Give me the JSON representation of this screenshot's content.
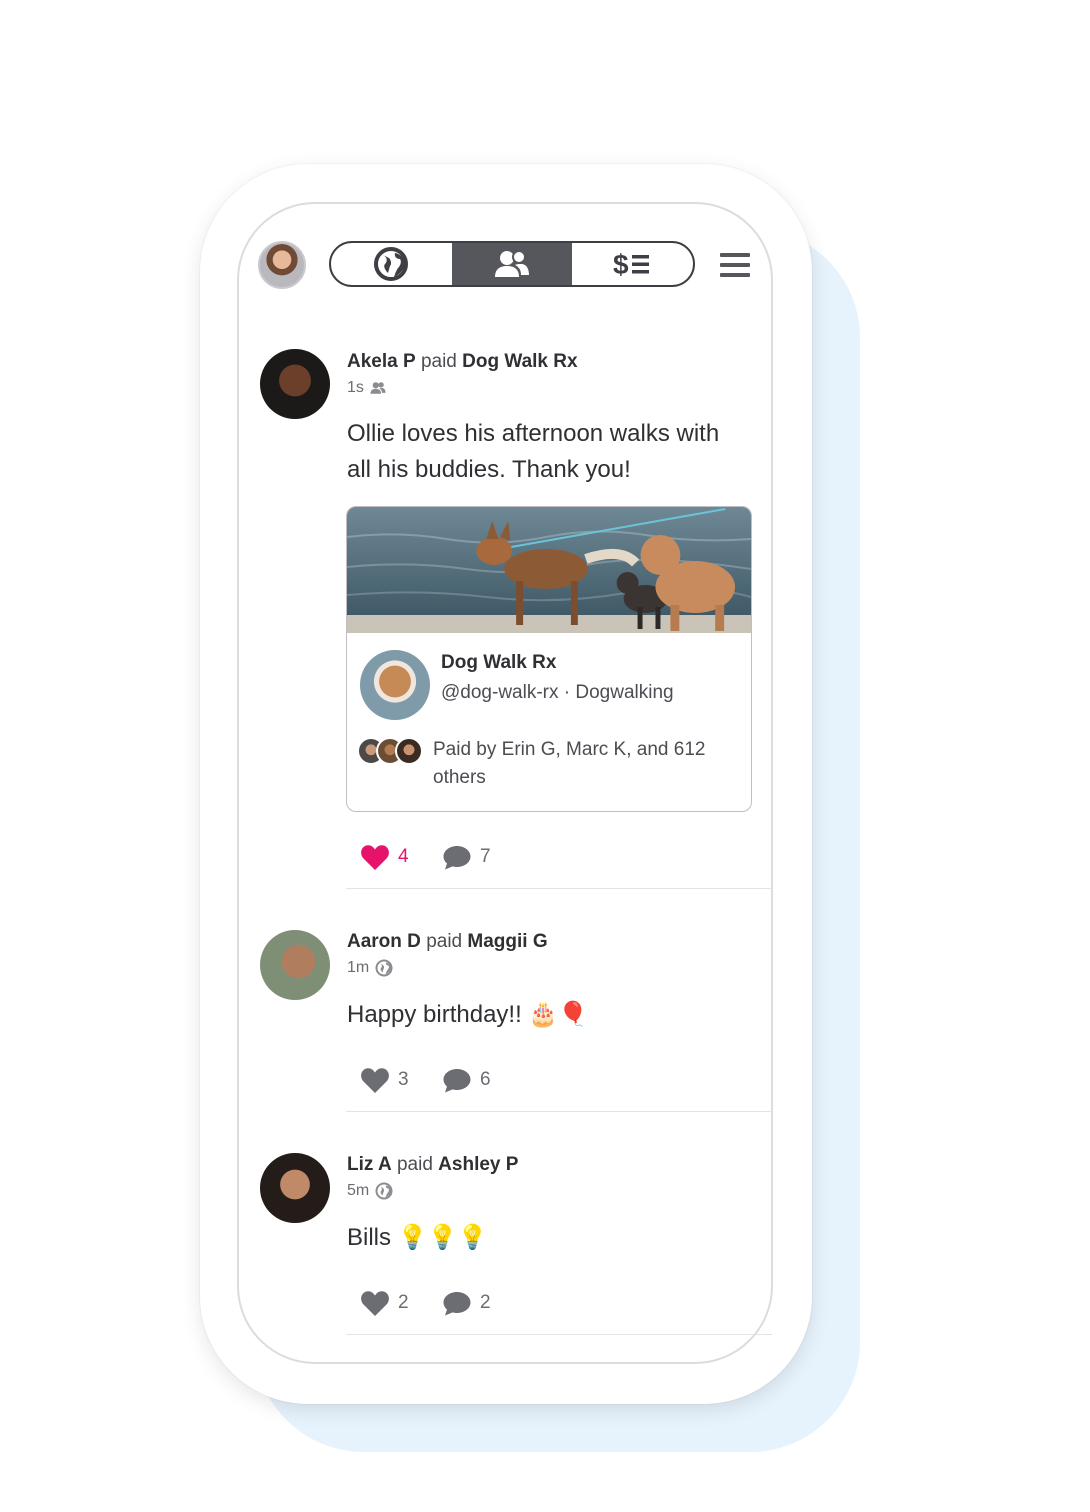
{
  "colors": {
    "accent_heart": "#e7136b",
    "icon_gray": "#6b6d72",
    "segment_active_bg": "#55575c",
    "backdrop_blue": "#e6f2fc"
  },
  "topbar": {
    "tabs": [
      {
        "icon": "globe-icon",
        "active": false
      },
      {
        "icon": "friends-icon",
        "active": true
      },
      {
        "icon": "dollar-list-icon",
        "active": false
      }
    ],
    "menu_icon": "hamburger-menu-icon"
  },
  "feed": [
    {
      "payer": "Akela P",
      "verb": "paid",
      "payee": "Dog Walk Rx",
      "time": "1s",
      "privacy_icon": "friends-icon",
      "message": "Ollie loves his afternoon walks with all his buddies. Thank you!",
      "card": {
        "business_name": "Dog Walk Rx",
        "handle_category": "@dog-walk-rx · Dogwalking",
        "paid_by": "Paid by Erin G, Marc K, and 612 others"
      },
      "likes": "4",
      "liked": true,
      "comments": "7"
    },
    {
      "payer": "Aaron D",
      "verb": "paid",
      "payee": "Maggii G",
      "time": "1m",
      "privacy_icon": "globe-icon",
      "message": "Happy birthday!! 🎂🎈",
      "likes": "3",
      "liked": false,
      "comments": "6"
    },
    {
      "payer": "Liz A",
      "verb": "paid",
      "payee": "Ashley P",
      "time": "5m",
      "privacy_icon": "globe-icon",
      "message": "Bills 💡💡💡",
      "likes": "2",
      "liked": false,
      "comments": "2"
    }
  ]
}
